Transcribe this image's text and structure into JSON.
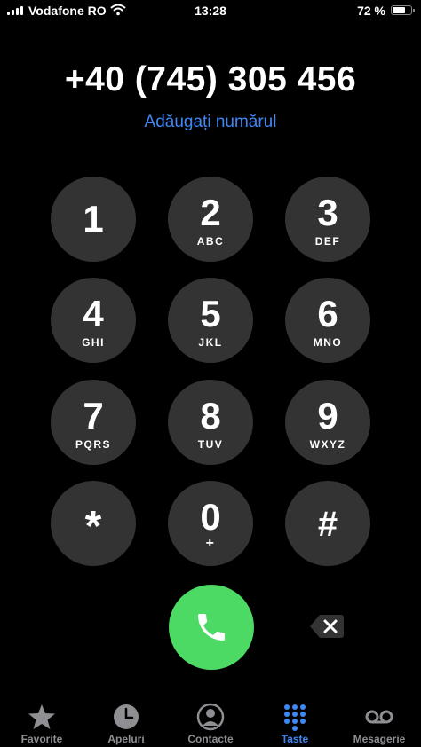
{
  "status_bar": {
    "carrier": "Vodafone RO",
    "time": "13:28",
    "battery_text": "72 %",
    "battery_level": 0.72
  },
  "dialer": {
    "number": "+40 (745) 305 456",
    "add_number_label": "Adăugați numărul"
  },
  "keypad": {
    "keys": [
      {
        "digit": "1",
        "letters": ""
      },
      {
        "digit": "2",
        "letters": "ABC"
      },
      {
        "digit": "3",
        "letters": "DEF"
      },
      {
        "digit": "4",
        "letters": "GHI"
      },
      {
        "digit": "5",
        "letters": "JKL"
      },
      {
        "digit": "6",
        "letters": "MNO"
      },
      {
        "digit": "7",
        "letters": "PQRS"
      },
      {
        "digit": "8",
        "letters": "TUV"
      },
      {
        "digit": "9",
        "letters": "WXYZ"
      },
      {
        "digit": "*",
        "letters": ""
      },
      {
        "digit": "0",
        "letters": "+"
      },
      {
        "digit": "#",
        "letters": ""
      }
    ]
  },
  "actions": {
    "call_icon": "phone-icon",
    "delete_icon": "delete-backspace-icon"
  },
  "tabbar": {
    "tabs": [
      {
        "label": "Favorite",
        "icon": "star-icon"
      },
      {
        "label": "Apeluri",
        "icon": "clock-icon"
      },
      {
        "label": "Contacte",
        "icon": "person-icon"
      },
      {
        "label": "Taste",
        "icon": "keypad-icon"
      },
      {
        "label": "Mesagerie",
        "icon": "voicemail-icon"
      }
    ],
    "active_tab": "Taste",
    "active_color": "#3f87f5"
  }
}
